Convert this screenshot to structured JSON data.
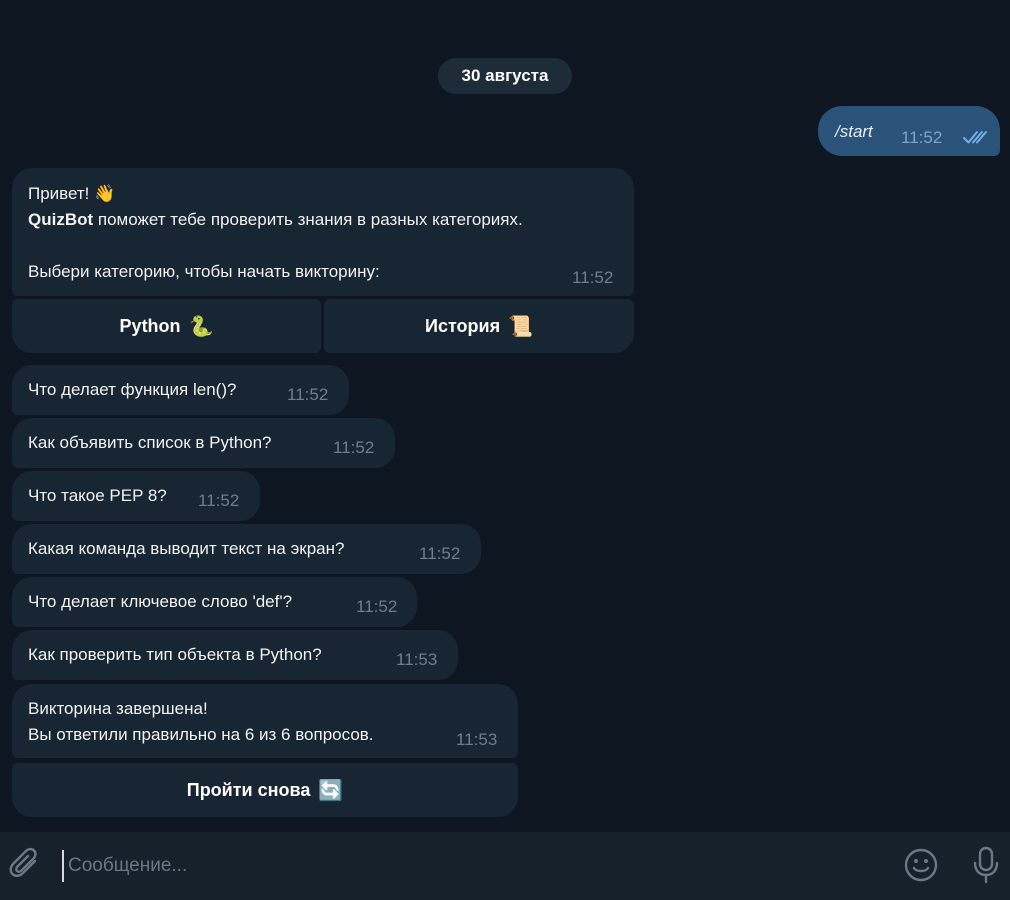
{
  "date_separator": "30 августа",
  "outgoing": {
    "text": "/start",
    "time": "11:52",
    "status_icon": "double-check-icon"
  },
  "welcome": {
    "greeting": "Привет! 👋",
    "bot_name": "QuizBot",
    "line2_rest": " поможет тебе проверить знания в разных категориях.",
    "line3": "Выбери категорию, чтобы начать викторину:",
    "time": "11:52"
  },
  "category_buttons": [
    {
      "label": "Python",
      "emoji": "🐍"
    },
    {
      "label": "История",
      "emoji": "📜"
    }
  ],
  "questions": [
    {
      "text": "Что делает функция len()?",
      "time": "11:52"
    },
    {
      "text": "Как объявить список в Python?",
      "time": "11:52"
    },
    {
      "text": "Что такое PEP 8?",
      "time": "11:52"
    },
    {
      "text": "Какая команда выводит текст на экран?",
      "time": "11:52"
    },
    {
      "text": "Что делает ключевое слово 'def'?",
      "time": "11:52"
    },
    {
      "text": "Как проверить тип объекта в Python?",
      "time": "11:53"
    }
  ],
  "result": {
    "line1": "Викторина завершена!",
    "line2": "Вы ответили правильно на 6 из 6 вопросов.",
    "time": "11:53"
  },
  "retry_button": {
    "label": "Пройти снова",
    "emoji": "🔄"
  },
  "composer": {
    "placeholder": "Сообщение..."
  },
  "colors": {
    "background": "#0e1621",
    "incoming_bubble": "#182533",
    "outgoing_bubble": "#2b5278",
    "composer": "#17212b",
    "timestamp": "#6d7f8f"
  }
}
